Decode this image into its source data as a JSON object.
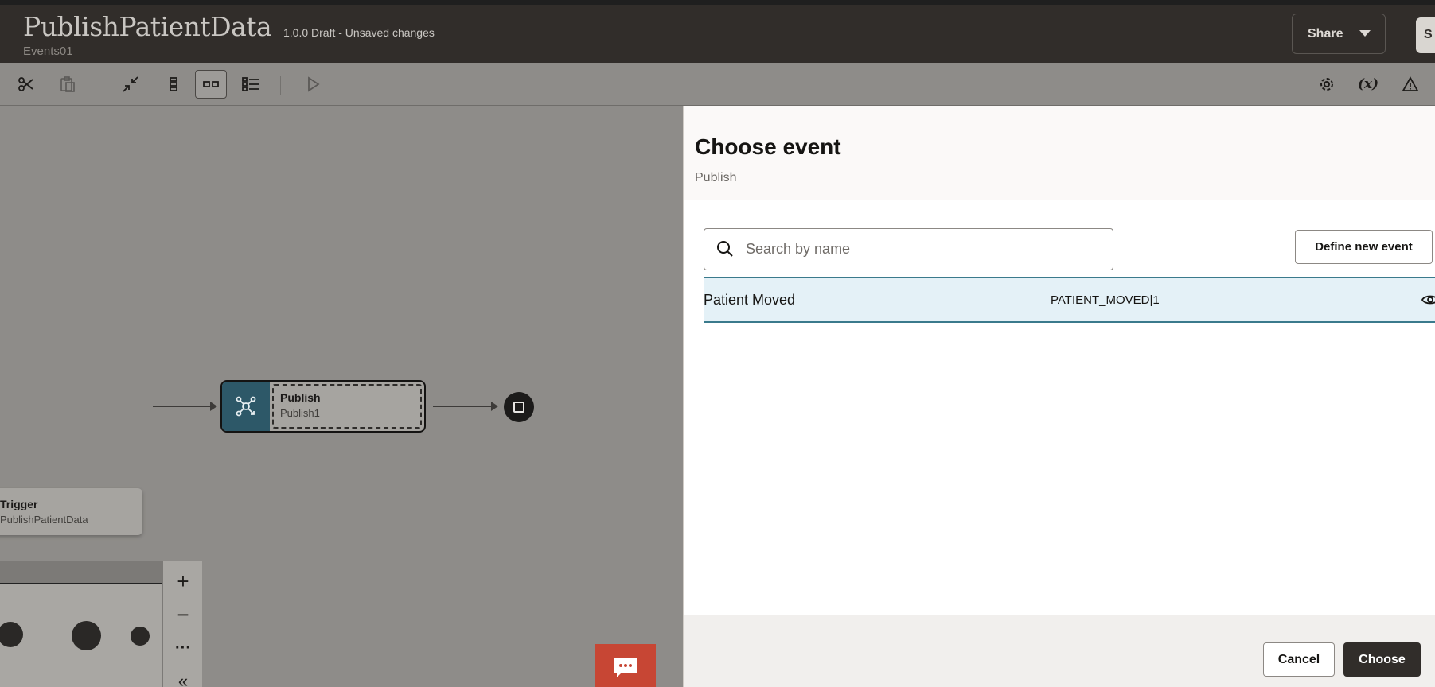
{
  "header": {
    "title": "PublishPatientData",
    "subtitle": "Events01",
    "version": "1.0.0 Draft - Unsaved changes",
    "share_label": "Share",
    "save_label": "S"
  },
  "toolbar": {
    "icons": [
      "scissors-icon",
      "paste-icon",
      "collapse-icon",
      "vertical-layout-icon",
      "horizontal-layout-icon",
      "list-layout-icon",
      "run-icon",
      "settings-icon",
      "variables-icon",
      "warning-icon"
    ],
    "variables_label": "(x)"
  },
  "canvas": {
    "trigger": {
      "title": "Trigger",
      "subtitle": "PublishPatientData"
    },
    "publish": {
      "title": "Publish",
      "subtitle": "Publish1"
    }
  },
  "zoom": {
    "plus": "+",
    "minus": "−",
    "more": "···",
    "collapse": "«"
  },
  "drawer": {
    "title": "Choose event",
    "subtitle": "Publish",
    "search_placeholder": "Search by name",
    "define_label": "Define new event",
    "events": [
      {
        "name": "Patient Moved",
        "id": "PATIENT_MOVED|1"
      }
    ],
    "cancel_label": "Cancel",
    "choose_label": "Choose"
  },
  "colors": {
    "header_bg": "#312d2a",
    "publish_icon_bg": "#2d5868",
    "selected_row_bg": "#e4f1f7",
    "chat_button": "#c74634"
  }
}
